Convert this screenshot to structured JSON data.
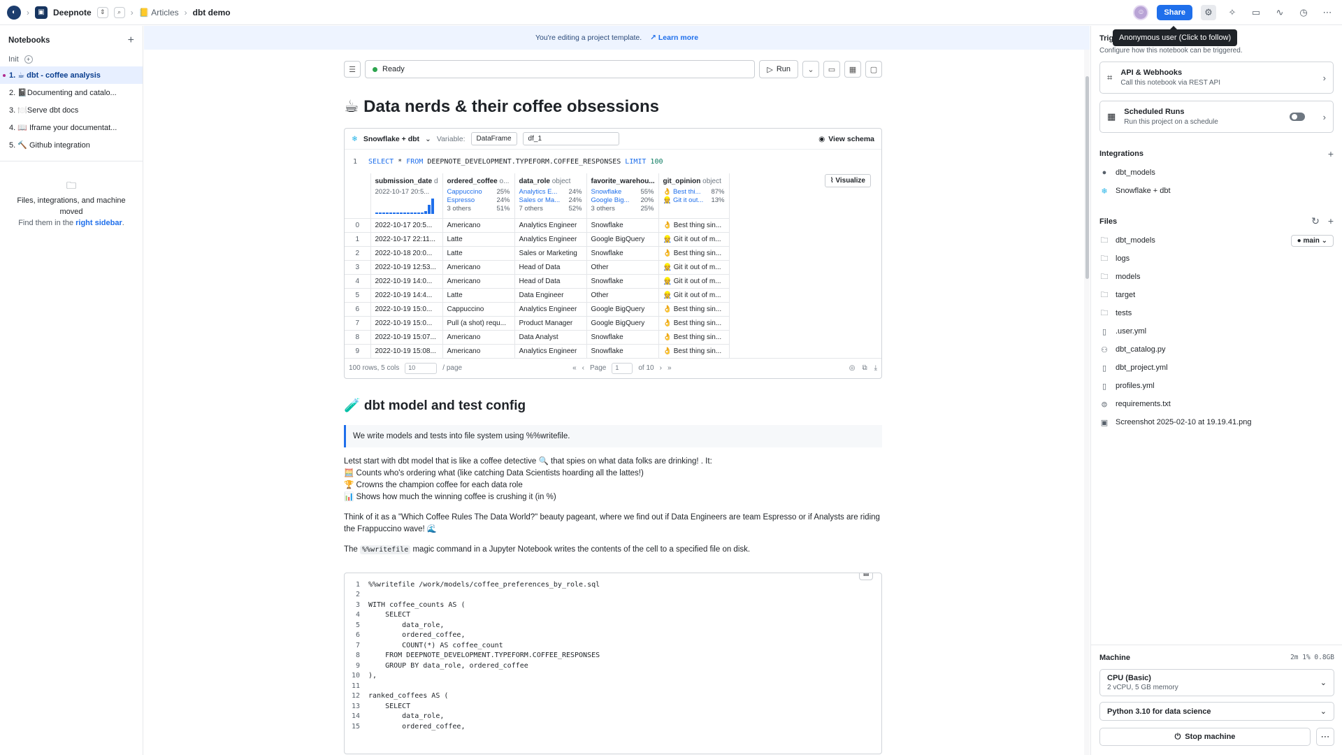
{
  "topbar": {
    "workspace": "Deepnote",
    "breadcrumb_folder": "📒 Articles",
    "breadcrumb_project": "dbt demo",
    "share_label": "Share",
    "tooltip": "Anonymous user (Click to follow)"
  },
  "left_sidebar": {
    "title": "Notebooks",
    "init_label": "Init",
    "notebooks": [
      "1. ☕ dbt - coffee analysis",
      "2. 📓Documenting and catalo...",
      "3. 🍽️Serve dbt docs",
      "4. 📖 Iframe your documentat...",
      "5. 🔨 Github integration"
    ],
    "moved_title": "Files, integrations, and machine moved",
    "moved_text": "Find them in the",
    "moved_link": "right sidebar",
    "moved_dot": "."
  },
  "banner": {
    "text": "You're editing a project template.",
    "link": "Learn more"
  },
  "notebook": {
    "status": "Ready",
    "run_label": "Run",
    "title": "☕ Data nerds & their coffee obsessions",
    "sql_cell": {
      "source": "Snowflake + dbt",
      "variable_label": "Variable:",
      "var_type": "DataFrame",
      "var_name": "df_1",
      "view_schema": "View schema",
      "visualize": "Visualize",
      "line_no": "1",
      "query_kw1": "SELECT",
      "query_star": " * ",
      "query_kw2": "FROM",
      "query_table": " DEEPNOTE_DEVELOPMENT.TYPEFORM.COFFEE_RESPONSES ",
      "query_kw3": "LIMIT",
      "query_limit": " 100"
    },
    "table": {
      "columns": [
        {
          "name": "submission_date",
          "type": "d"
        },
        {
          "name": "ordered_coffee",
          "type": "o..."
        },
        {
          "name": "data_role",
          "type": "object"
        },
        {
          "name": "favorite_warehou...",
          "type": ""
        },
        {
          "name": "git_opinion",
          "type": "object"
        }
      ],
      "date_stat": "2022-10-17 20:5...",
      "stats": [
        [
          [
            "Cappuccino",
            "25%"
          ],
          [
            "Espresso",
            "24%"
          ],
          [
            "3 others",
            "51%"
          ]
        ],
        [
          [
            "Analytics E...",
            "24%"
          ],
          [
            "Sales or Ma...",
            "24%"
          ],
          [
            "7 others",
            "52%"
          ]
        ],
        [
          [
            "Snowflake",
            "55%"
          ],
          [
            "Google Big...",
            "20%"
          ],
          [
            "3 others",
            "25%"
          ]
        ],
        [
          [
            "👌 Best thi...",
            "87%"
          ],
          [
            "👷 Git it out...",
            "13%"
          ]
        ]
      ],
      "minichart_values": [
        1,
        1,
        1,
        1,
        1,
        1,
        1,
        1,
        1,
        1,
        1,
        1,
        1,
        1,
        2,
        6,
        10
      ],
      "rows": [
        [
          "0",
          "2022-10-17 20:5...",
          "Americano",
          "Analytics Engineer",
          "Snowflake",
          "👌 Best thing sin..."
        ],
        [
          "1",
          "2022-10-17 22:11...",
          "Latte",
          "Analytics Engineer",
          "Google BigQuery",
          "👷 Git it out of m..."
        ],
        [
          "2",
          "2022-10-18 20:0...",
          "Latte",
          "Sales or Marketing",
          "Snowflake",
          "👌 Best thing sin..."
        ],
        [
          "3",
          "2022-10-19 12:53...",
          "Americano",
          "Head of Data",
          "Other",
          "👷 Git it out of m..."
        ],
        [
          "4",
          "2022-10-19 14:0...",
          "Americano",
          "Head of Data",
          "Snowflake",
          "👷 Git it out of m..."
        ],
        [
          "5",
          "2022-10-19 14:4...",
          "Latte",
          "Data Engineer",
          "Other",
          "👷 Git it out of m..."
        ],
        [
          "6",
          "2022-10-19 15:0...",
          "Cappuccino",
          "Analytics Engineer",
          "Google BigQuery",
          "👌 Best thing sin..."
        ],
        [
          "7",
          "2022-10-19 15:0...",
          "Pull (a shot) requ...",
          "Product Manager",
          "Google BigQuery",
          "👌 Best thing sin..."
        ],
        [
          "8",
          "2022-10-19 15:07...",
          "Americano",
          "Data Analyst",
          "Snowflake",
          "👌 Best thing sin..."
        ],
        [
          "9",
          "2022-10-19 15:08...",
          "Americano",
          "Analytics Engineer",
          "Snowflake",
          "👌 Best thing sin..."
        ]
      ],
      "footer_rows": "100 rows, 5 cols",
      "page_size": "10",
      "per_page": "/ page",
      "page_label": "Page",
      "page_value": "1",
      "of_pages": "of 10"
    },
    "h2": "🧪 dbt model and test config",
    "callout": "We write models and tests into file system using %%writefile.",
    "paragraph1": [
      "Letst start with dbt model that is like a coffee detective 🔍 that spies on what data folks are drinking! . It:",
      "🧮 Counts who's ordering what (like catching Data Scientists hoarding all the lattes!)",
      "🏆 Crowns the champion coffee for each data role",
      "📊 Shows how much the winning coffee is crushing it (in %)"
    ],
    "paragraph2": "Think of it as a \"Which Coffee Rules The Data World?\" beauty pageant, where we find out if Data Engineers are team Espresso or if Analysts are riding the Frappuccino wave! 🌊",
    "paragraph3_pre": "The",
    "paragraph3_code": "%%writefile",
    "paragraph3_post": "magic command in a Jupyter Notebook writes the contents of the cell to a specified file on disk.",
    "code_lines": [
      "%%writefile /work/models/coffee_preferences_by_role.sql",
      "",
      "WITH coffee_counts AS (",
      "    SELECT",
      "        data_role,",
      "        ordered_coffee,",
      "        COUNT(*) AS coffee_count",
      "    FROM DEEPNOTE_DEVELOPMENT.TYPEFORM.COFFEE_RESPONSES",
      "    GROUP BY data_role, ordered_coffee",
      "),",
      "",
      "ranked_coffees AS (",
      "    SELECT",
      "        data_role,",
      "        ordered_coffee,"
    ]
  },
  "right_sidebar": {
    "triggers_title": "Triggers",
    "triggers_sub": "Configure how this notebook can be triggered.",
    "api_title": "API & Webhooks",
    "api_sub": "Call this notebook via REST API",
    "sched_title": "Scheduled Runs",
    "sched_sub": "Run this project on a schedule",
    "integrations_title": "Integrations",
    "integrations": [
      "dbt_models",
      "Snowflake + dbt"
    ],
    "files_title": "Files",
    "branch": "main",
    "folders": [
      "dbt_models",
      "logs",
      "models",
      "target",
      "tests"
    ],
    "files": [
      ".user.yml",
      "dbt_catalog.py",
      "dbt_project.yml",
      "profiles.yml",
      "requirements.txt",
      "Screenshot 2025-02-10 at 19.19.41.png"
    ],
    "machine_title": "Machine",
    "machine_res": "2m  1%  0.8GB",
    "cpu_title": "CPU (Basic)",
    "cpu_sub": "2 vCPU, 5 GB memory",
    "python": "Python 3.10 for data science",
    "stop": "Stop machine"
  }
}
